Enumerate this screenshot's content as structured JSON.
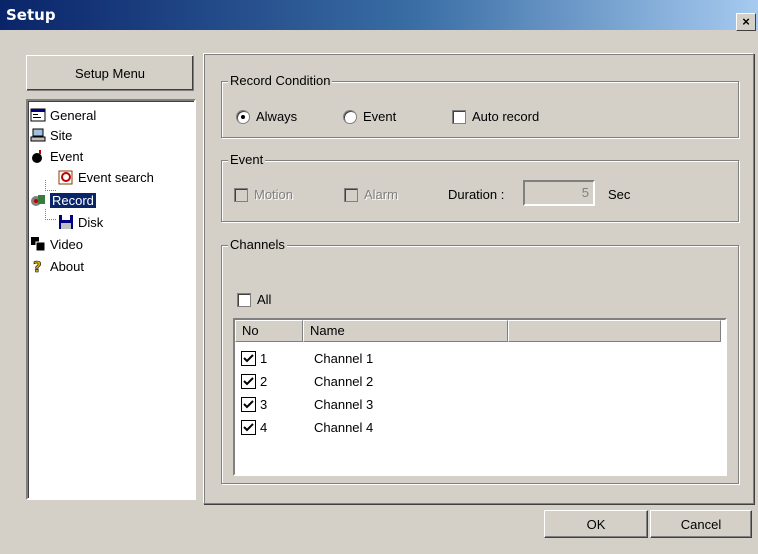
{
  "window": {
    "title": "Setup",
    "close_label": "×"
  },
  "sidebar": {
    "menu_button": "Setup Menu",
    "items": [
      {
        "label": "General",
        "icon": "general-icon"
      },
      {
        "label": "Site",
        "icon": "site-icon"
      },
      {
        "label": "Event",
        "icon": "event-icon"
      },
      {
        "label": "Event search",
        "icon": "event-search-icon"
      },
      {
        "label": "Record",
        "icon": "record-icon",
        "selected": true
      },
      {
        "label": "Disk",
        "icon": "disk-icon"
      },
      {
        "label": "Video",
        "icon": "video-icon"
      },
      {
        "label": "About",
        "icon": "about-icon"
      }
    ]
  },
  "record_condition": {
    "title": "Record Condition",
    "always": "Always",
    "event": "Event",
    "auto_record": "Auto record",
    "selected": "Always",
    "auto_record_checked": false
  },
  "event_group": {
    "title": "Event",
    "motion": "Motion",
    "alarm": "Alarm",
    "duration_label": "Duration :",
    "duration_value": "5",
    "duration_unit": "Sec"
  },
  "channels": {
    "title": "Channels",
    "all_label": "All",
    "all_checked": false,
    "columns": [
      "No",
      "Name",
      ""
    ],
    "rows": [
      {
        "no": "1",
        "name": "Channel 1",
        "checked": true
      },
      {
        "no": "2",
        "name": "Channel 2",
        "checked": true
      },
      {
        "no": "3",
        "name": "Channel 3",
        "checked": true
      },
      {
        "no": "4",
        "name": "Channel 4",
        "checked": true
      }
    ]
  },
  "buttons": {
    "ok": "OK",
    "cancel": "Cancel"
  }
}
